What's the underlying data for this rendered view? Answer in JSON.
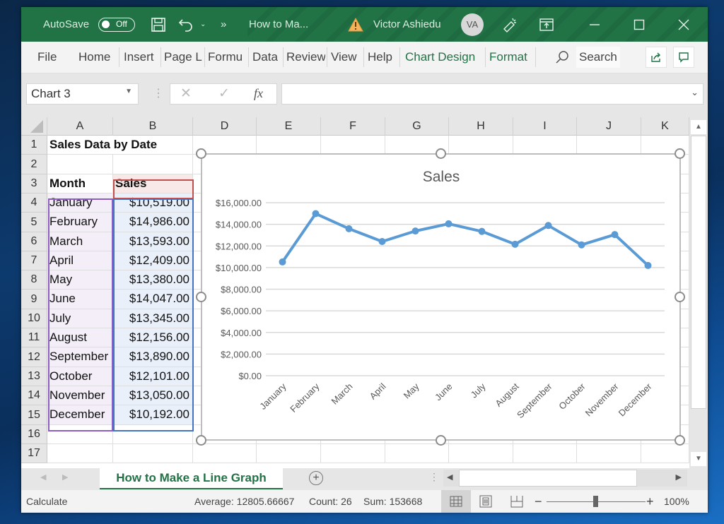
{
  "titlebar": {
    "autosave_label": "AutoSave",
    "autosave_state": "Off",
    "more_label": "»",
    "doc_title": "How to Ma...",
    "user_name": "Victor Ashiedu",
    "user_initials": "VA"
  },
  "ribbon": {
    "tabs": [
      "File",
      "Home",
      "Insert",
      "Page L",
      "Formu",
      "Data",
      "Review",
      "View",
      "Help",
      "Chart Design",
      "Format"
    ],
    "search_label": "Search"
  },
  "formula_bar": {
    "name_box": "Chart 3",
    "cancel": "✕",
    "enter": "✓",
    "fx": "fx",
    "formula": ""
  },
  "grid": {
    "columns": [
      "A",
      "B",
      "D",
      "E",
      "F",
      "G",
      "H",
      "I",
      "J",
      "K"
    ],
    "rows": [
      "1",
      "2",
      "3",
      "4",
      "5",
      "6",
      "7",
      "8",
      "9",
      "10",
      "11",
      "12",
      "13",
      "14",
      "15",
      "16",
      "17"
    ],
    "title": "Sales Data by Date",
    "header_month": "Month",
    "header_sales": "Sales",
    "months": [
      "January",
      "February",
      "March",
      "April",
      "May",
      "June",
      "July",
      "August",
      "September",
      "October",
      "November",
      "December"
    ],
    "sales": [
      "$10,519.00",
      "$14,986.00",
      "$13,593.00",
      "$12,409.00",
      "$13,380.00",
      "$14,047.00",
      "$13,345.00",
      "$12,156.00",
      "$13,890.00",
      "$12,101.00",
      "$13,050.00",
      "$10,192.00"
    ]
  },
  "chart_data": {
    "type": "line",
    "title": "Sales",
    "categories": [
      "January",
      "February",
      "March",
      "April",
      "May",
      "June",
      "July",
      "August",
      "September",
      "October",
      "November",
      "December"
    ],
    "series": [
      {
        "name": "Sales",
        "values": [
          10519,
          14986,
          13593,
          12409,
          13380,
          14047,
          13345,
          12156,
          13890,
          12101,
          13050,
          10192
        ],
        "color": "#5b9bd5"
      }
    ],
    "y_ticks": [
      "$0.00",
      "$2,000.00",
      "$4,000.00",
      "$6,000.00",
      "$8,000.00",
      "$10,000.00",
      "$12,000.00",
      "$14,000.00",
      "$16,000.00"
    ],
    "ylim": [
      0,
      16000
    ],
    "xlabel": "",
    "ylabel": "",
    "grid": true,
    "legend": "none"
  },
  "sheets": {
    "active": "How to Make a Line Graph"
  },
  "status": {
    "mode": "Calculate",
    "average": "Average: 12805.66667",
    "count": "Count: 26",
    "sum": "Sum: 153668",
    "zoom": "100%"
  },
  "colors": {
    "excel_green": "#217346",
    "series": "#5b9bd5"
  }
}
